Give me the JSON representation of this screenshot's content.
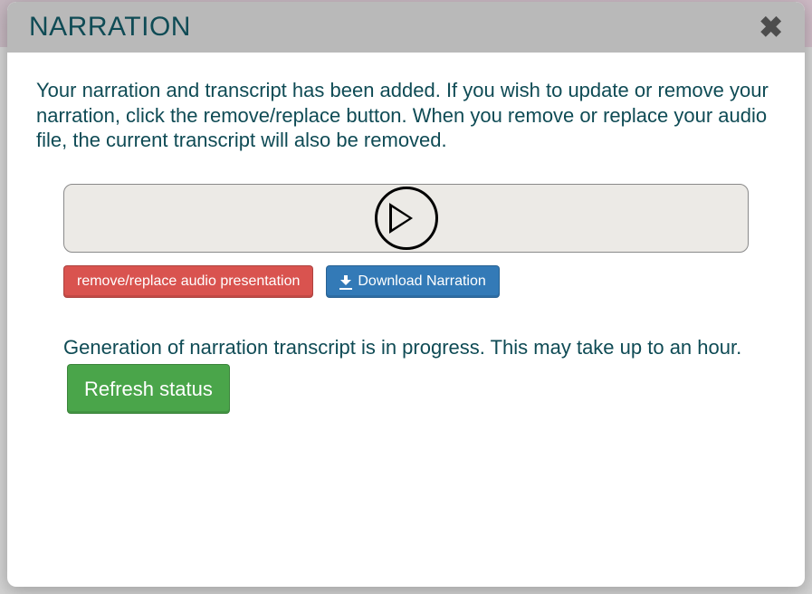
{
  "modal": {
    "title": "NARRATION",
    "intro": "Your narration and transcript has been added. If you wish to update or remove your narration, click the remove/replace button. When you remove or replace your audio file, the current transcript will also be removed.",
    "buttons": {
      "remove_replace": "remove/replace audio presentation",
      "download": "Download Narration",
      "refresh": "Refresh status"
    },
    "status_text": "Generation of narration transcript is in progress. This may take up to an hour."
  }
}
